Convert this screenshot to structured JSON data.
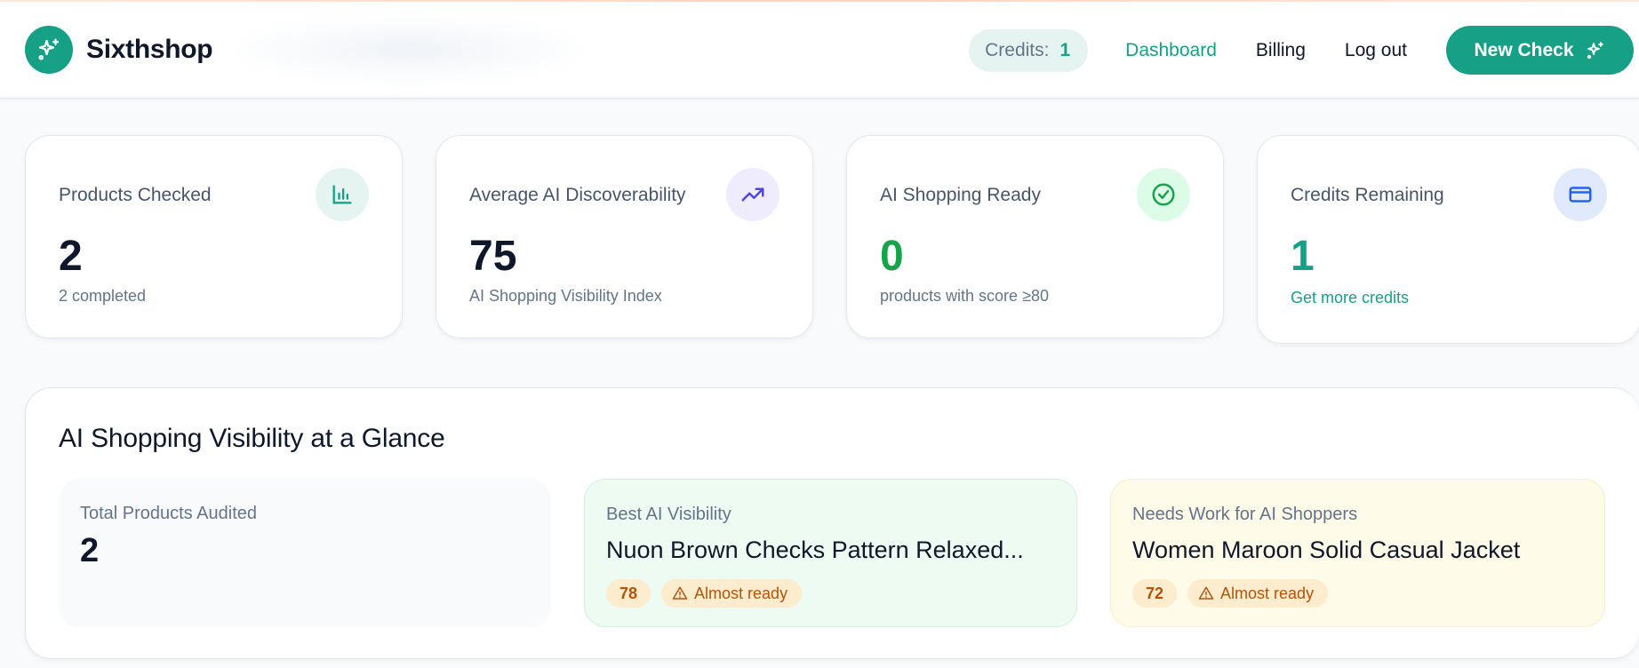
{
  "header": {
    "brand_name": "Sixthshop",
    "credits_label": "Credits:",
    "credits_value": "1",
    "nav": {
      "dashboard": "Dashboard",
      "billing": "Billing",
      "logout": "Log out"
    },
    "new_check_label": "New Check"
  },
  "stats": [
    {
      "label": "Products Checked",
      "value": "2",
      "sub": "2 completed",
      "icon": "bar-chart-icon",
      "value_color": "#0f172a",
      "icon_bg": "#e6f4f1",
      "icon_color": "#16a085"
    },
    {
      "label": "Average AI Discoverability",
      "value": "75",
      "sub": "AI Shopping Visibility Index",
      "icon": "trending-up-icon",
      "value_color": "#0f172a",
      "icon_bg": "#efedfd",
      "icon_color": "#4f46e5"
    },
    {
      "label": "AI Shopping Ready",
      "value": "0",
      "sub": "products with score ≥80",
      "icon": "check-circle-icon",
      "value_color": "#16a34a",
      "icon_bg": "#dcfce7",
      "icon_color": "#16a34a"
    },
    {
      "label": "Credits Remaining",
      "value": "1",
      "sub": "Get more credits",
      "icon": "credit-card-icon",
      "value_color": "#16a085",
      "icon_bg": "#e0eafc",
      "icon_color": "#2563eb"
    }
  ],
  "glance": {
    "title": "AI Shopping Visibility at a Glance",
    "total": {
      "label": "Total Products Audited",
      "value": "2"
    },
    "best": {
      "label": "Best AI Visibility",
      "name": "Nuon Brown Checks Pattern Relaxed...",
      "score": "78",
      "status": "Almost ready"
    },
    "needs_work": {
      "label": "Needs Work for AI Shoppers",
      "name": "Women Maroon Solid Casual Jacket",
      "score": "72",
      "status": "Almost ready"
    }
  },
  "colors": {
    "accent": "#16a085",
    "page_bg": "#f8fafc",
    "best_tile_bg": "#edfbf2",
    "needs_tile_bg": "#fefbe8",
    "badge_bg": "#fdeccd",
    "badge_text": "#b45309"
  }
}
